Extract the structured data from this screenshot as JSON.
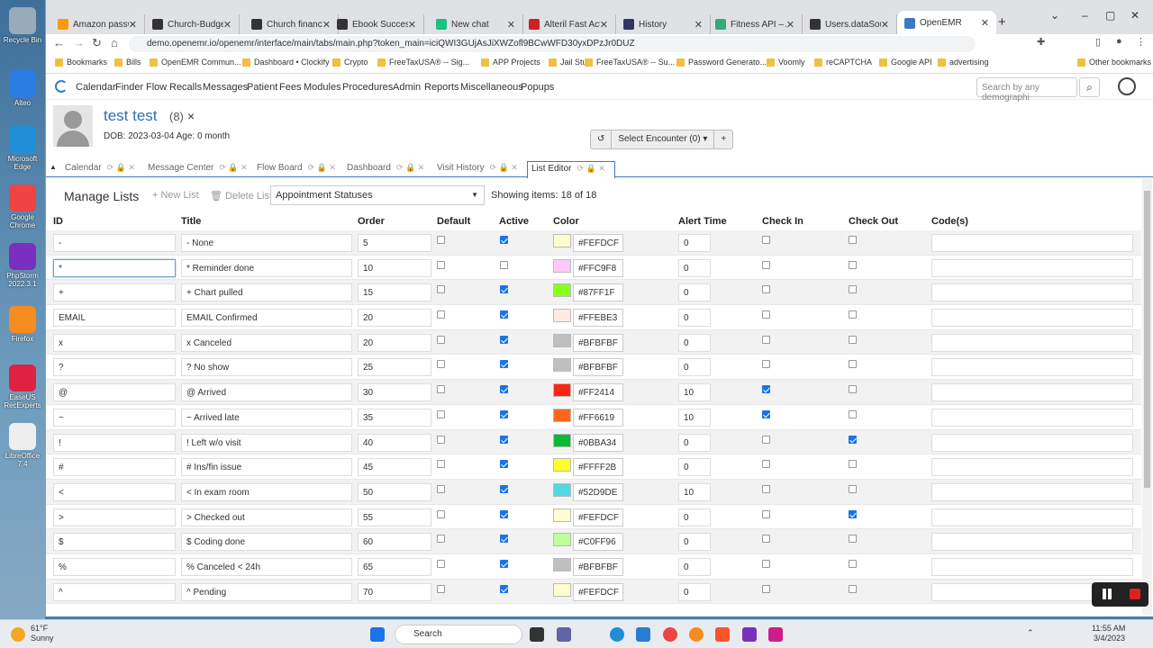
{
  "desktop_icons": [
    {
      "label": "Recycle Bin",
      "color": "#9ab"
    },
    {
      "label": "Alteo",
      "color": "#2c7be5"
    },
    {
      "label": "Microsoft Edge",
      "color": "#1e8fd6"
    },
    {
      "label": "Google Chrome",
      "color": "#e44"
    },
    {
      "label": "PhpStorm 2022.3.1",
      "color": "#7b2fbf"
    },
    {
      "label": "Firefox",
      "color": "#f68b1f"
    },
    {
      "label": "EaseUS RecExperts",
      "color": "#d24"
    },
    {
      "label": "LibreOffice 7.4",
      "color": "#eee"
    }
  ],
  "browser": {
    "tabs": [
      {
        "label": "Amazon password",
        "color": "#f90"
      },
      {
        "label": "Church-Budgeting",
        "color": "#333"
      },
      {
        "label": "Church finances",
        "color": "#333"
      },
      {
        "label": "Ebook Success",
        "color": "#333"
      },
      {
        "label": "New chat",
        "color": "#19c37d"
      },
      {
        "label": "Alteril Fast Acting",
        "color": "#c22"
      },
      {
        "label": "History",
        "color": "#336"
      },
      {
        "label": "Fitness API – API",
        "color": "#3a7"
      },
      {
        "label": "Users.dataSource",
        "color": "#333"
      },
      {
        "label": "OpenEMR",
        "color": "#3c7ac0",
        "active": true
      }
    ],
    "url": "demo.openemr.io/openemr/interface/main/tabs/main.php?token_main=iciQWI3GUjAsJiXWZofl9BCwWFD30yxDPzJr0DUZ",
    "bookmarks": [
      "Bookmarks",
      "Bills",
      "OpenEMR Commun...",
      "Dashboard • Clockify",
      "Crypto",
      "FreeTaxUSA® -- Sig...",
      "APP Projects",
      "Jail Stuff",
      "FreeTaxUSA® -- Su...",
      "Password Generato...",
      "Voomly",
      "reCAPTCHA",
      "Google API",
      "advertising"
    ],
    "other_bookmarks": "Other bookmarks"
  },
  "emr": {
    "menu": [
      "Calendar",
      "Finder",
      "Flow",
      "Recalls",
      "Messages",
      "Patient",
      "Fees",
      "Modules",
      "Procedures",
      "Admin",
      "Reports",
      "Miscellaneous",
      "Popups"
    ],
    "search_placeholder": "Search by any demographi",
    "patient": {
      "name": "test test",
      "count": "(8)",
      "close": "×",
      "dob": "DOB: 2023-03-04 Age: 0 month"
    },
    "encounter": {
      "label": "Select Encounter",
      "count": "(0)",
      "add": "+"
    },
    "tabs": [
      "Calendar",
      "Message Center",
      "Flow Board",
      "Dashboard",
      "Visit History",
      "List Editor"
    ],
    "active_tab": "List Editor"
  },
  "list": {
    "title": "Manage Lists",
    "new_list": "New List",
    "delete_list": "Delete List",
    "selected_list": "Appointment Statuses",
    "showing": "Showing items: 18 of 18",
    "columns": [
      "ID",
      "Title",
      "Order",
      "Default",
      "Active",
      "Color",
      "Alert Time",
      "Check In",
      "Check Out",
      "Code(s)"
    ],
    "rows": [
      {
        "id": "-",
        "title": "- None",
        "order": "5",
        "default": false,
        "active": true,
        "color": "#FEFDCF",
        "alert": "0",
        "checkin": false,
        "checkout": false
      },
      {
        "id": "*",
        "title": "* Reminder done",
        "order": "10",
        "default": false,
        "active": false,
        "color": "#FFC9F8",
        "alert": "0",
        "checkin": false,
        "checkout": false
      },
      {
        "id": "+",
        "title": "+ Chart pulled",
        "order": "15",
        "default": false,
        "active": true,
        "color": "#87FF1F",
        "alert": "0",
        "checkin": false,
        "checkout": false
      },
      {
        "id": "EMAIL",
        "title": "EMAIL Confirmed",
        "order": "20",
        "default": false,
        "active": true,
        "color": "#FFEBE3",
        "alert": "0",
        "checkin": false,
        "checkout": false
      },
      {
        "id": "x",
        "title": "x Canceled",
        "order": "20",
        "default": false,
        "active": true,
        "color": "#BFBFBF",
        "alert": "0",
        "checkin": false,
        "checkout": false
      },
      {
        "id": "?",
        "title": "? No show",
        "order": "25",
        "default": false,
        "active": true,
        "color": "#BFBFBF",
        "alert": "0",
        "checkin": false,
        "checkout": false
      },
      {
        "id": "@",
        "title": "@ Arrived",
        "order": "30",
        "default": false,
        "active": true,
        "color": "#FF2414",
        "alert": "10",
        "checkin": true,
        "checkout": false
      },
      {
        "id": "~",
        "title": "~ Arrived late",
        "order": "35",
        "default": false,
        "active": true,
        "color": "#FF6619",
        "alert": "10",
        "checkin": true,
        "checkout": false
      },
      {
        "id": "!",
        "title": "! Left w/o visit",
        "order": "40",
        "default": false,
        "active": true,
        "color": "#0BBA34",
        "alert": "0",
        "checkin": false,
        "checkout": true
      },
      {
        "id": "#",
        "title": "# Ins/fin issue",
        "order": "45",
        "default": false,
        "active": true,
        "color": "#FFFF2B",
        "alert": "0",
        "checkin": false,
        "checkout": false
      },
      {
        "id": "<",
        "title": "< In exam room",
        "order": "50",
        "default": false,
        "active": true,
        "color": "#52D9DE",
        "alert": "10",
        "checkin": false,
        "checkout": false
      },
      {
        "id": ">",
        "title": "> Checked out",
        "order": "55",
        "default": false,
        "active": true,
        "color": "#FEFDCF",
        "alert": "0",
        "checkin": false,
        "checkout": true
      },
      {
        "id": "$",
        "title": "$ Coding done",
        "order": "60",
        "default": false,
        "active": true,
        "color": "#C0FF96",
        "alert": "0",
        "checkin": false,
        "checkout": false
      },
      {
        "id": "%",
        "title": "% Canceled < 24h",
        "order": "65",
        "default": false,
        "active": true,
        "color": "#BFBFBF",
        "alert": "0",
        "checkin": false,
        "checkout": false
      },
      {
        "id": "^",
        "title": "^ Pending",
        "order": "70",
        "default": false,
        "active": true,
        "color": "#FEFDCF",
        "alert": "0",
        "checkin": false,
        "checkout": false
      }
    ]
  },
  "taskbar": {
    "weather_temp": "61°F",
    "weather_text": "Sunny",
    "search": "Search",
    "time": "11:55 AM",
    "date": "3/4/2023"
  }
}
